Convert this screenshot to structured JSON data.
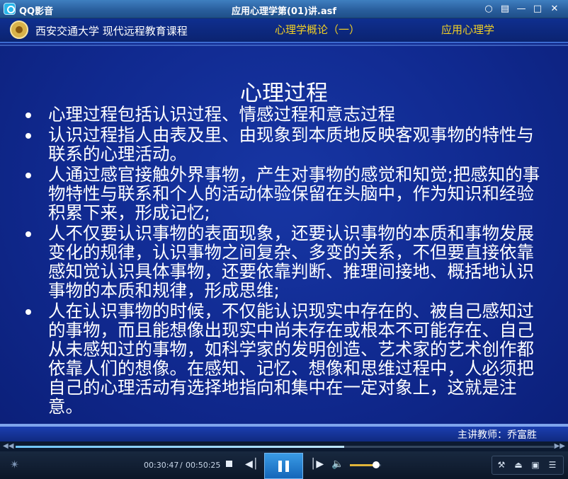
{
  "window": {
    "app_name": "QQ影音",
    "file_title": "应用心理学第(01)讲.asf"
  },
  "slide": {
    "institution": "西安交通大学  现代远程教育课程",
    "lecture_title": "心理学概论（一）",
    "course_name": "应用心理学",
    "title": "心理过程",
    "bullets": [
      "心理过程包括认识过程、情感过程和意志过程",
      "认识过程指人由表及里、由现象到本质地反映客观事物的特性与联系的心理活动。",
      "人通过感官接触外界事物，产生对事物的感觉和知觉;把感知的事物特性与联系和个人的活动体验保留在头脑中，作为知识和经验积累下来，形成记忆;",
      "人不仅要认识事物的表面现象，还要认识事物的本质和事物发展变化的规律，认识事物之间复杂、多变的关系，不但要直接依靠感知觉认识具体事物，还要依靠判断、推理间接地、概括地认识事物的本质和规律，形成思维;",
      "人在认识事物的时候，不仅能认识现实中存在的、被自己感知过的事物，而且能想像出现实中尚未存在或根本不可能存在、自己从未感知过的事物，如科学家的发明创造、艺术家的艺术创作都依靠人们的想像。在感知、记忆、想像和思维过程中，人必须把自己的心理活动有选择地指向和集中在一定对象上，这就是注意。"
    ],
    "teacher": "主讲教师：乔富胜"
  },
  "player": {
    "current_time": "00:30:47",
    "separator": "/",
    "total_time": "00:50:25",
    "seek_fraction": 0.61,
    "volume_fraction": 0.85,
    "seek_left_glyph": "◀◀",
    "seek_right_glyph": "▶▶"
  },
  "icons": {
    "app_logo": "qq-player-logo-icon",
    "chat": "chat-bubble-icon",
    "skin": "skin-icon",
    "minimize": "minimize-icon",
    "maximize": "maximize-icon",
    "close": "close-icon",
    "footprint": "footprint-icon",
    "stop": "stop-icon",
    "previous": "previous-icon",
    "pause": "pause-icon",
    "next": "next-icon",
    "volume": "volume-icon",
    "toolbox": "toolbox-icon",
    "eject": "eject-icon",
    "screen": "screen-icon",
    "playlist": "playlist-icon"
  },
  "colors": {
    "slide_background": "#10298f",
    "slide_accent_text": "#f2d024",
    "play_button": "#1f7fd0",
    "volume_fill": "#e1b53a"
  }
}
